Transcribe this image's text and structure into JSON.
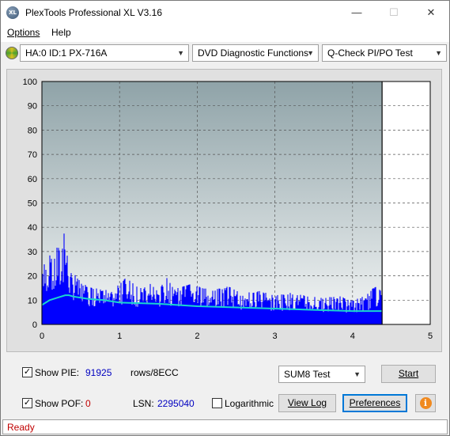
{
  "window": {
    "title": "PlexTools Professional XL V3.16",
    "icon_text": "XL",
    "minimize": "—",
    "maximize": "☐",
    "close": "✕"
  },
  "menu": [
    {
      "label": "Options"
    },
    {
      "label": "Help"
    }
  ],
  "toolbar": {
    "drive": "HA:0 ID:1  PX-716A",
    "function": "DVD Diagnostic Functions",
    "test": "Q-Check PI/PO Test"
  },
  "chart_data": {
    "type": "area",
    "y_axis": {
      "min": 0,
      "max": 100,
      "ticks": [
        "0",
        "10",
        "20",
        "30",
        "40",
        "50",
        "60",
        "70",
        "80",
        "90",
        "100"
      ]
    },
    "x_axis": {
      "min": 0,
      "max": 5,
      "ticks": [
        "0",
        "1",
        "2",
        "3",
        "4",
        "5"
      ]
    },
    "data_end_x": 4.38,
    "grid": true,
    "colors": {
      "bars": "#0000ff",
      "average_line": "#19d6ce",
      "background": "#8fa3a8"
    },
    "series": [
      {
        "kind": "bars_envelope",
        "x": [
          0.0,
          0.05,
          0.1,
          0.15,
          0.2,
          0.25,
          0.3,
          0.35,
          0.4,
          0.45,
          0.5,
          0.6,
          0.7,
          0.8,
          0.9,
          1.0,
          1.1,
          1.2,
          1.3,
          1.4,
          1.5,
          1.6,
          1.7,
          1.8,
          1.9,
          2.0,
          2.2,
          2.4,
          2.6,
          2.8,
          3.0,
          3.2,
          3.4,
          3.6,
          3.8,
          4.0,
          4.1,
          4.2,
          4.3,
          4.38
        ],
        "values": [
          20,
          28,
          30,
          25,
          33,
          28,
          43,
          26,
          22,
          20,
          17,
          16,
          15,
          14,
          15,
          17,
          20,
          16,
          15,
          17,
          14,
          20,
          15,
          16,
          17,
          16,
          14,
          16,
          13,
          14,
          12,
          13,
          12,
          11,
          12,
          10,
          11,
          13,
          16,
          17
        ]
      },
      {
        "kind": "average_line",
        "x": [
          0.0,
          0.05,
          0.1,
          0.2,
          0.3,
          0.35,
          0.4,
          0.5,
          0.6,
          0.8,
          1.0,
          1.5,
          2.0,
          2.5,
          3.0,
          3.5,
          4.0,
          4.38
        ],
        "values": [
          8,
          9,
          10,
          11,
          12,
          12,
          11.5,
          11,
          10.5,
          10,
          9,
          8.5,
          7.5,
          7,
          6.5,
          6,
          5.5,
          5.5
        ]
      }
    ]
  },
  "controls": {
    "show_pie_label": "Show PIE:",
    "show_pie_checked": "✓",
    "pie_value": "91925",
    "rows_label": "rows/8ECC",
    "show_pof_label": "Show POF:",
    "show_pof_checked": "✓",
    "pof_value": "0",
    "lsn_label": "LSN:",
    "lsn_value": "2295040",
    "log_label": "Logarithmic",
    "test_select": "SUM8 Test",
    "start": "Start",
    "view_log": "View Log",
    "preferences": "Preferences",
    "info_icon_text": "i"
  },
  "status": {
    "text": "Ready"
  }
}
